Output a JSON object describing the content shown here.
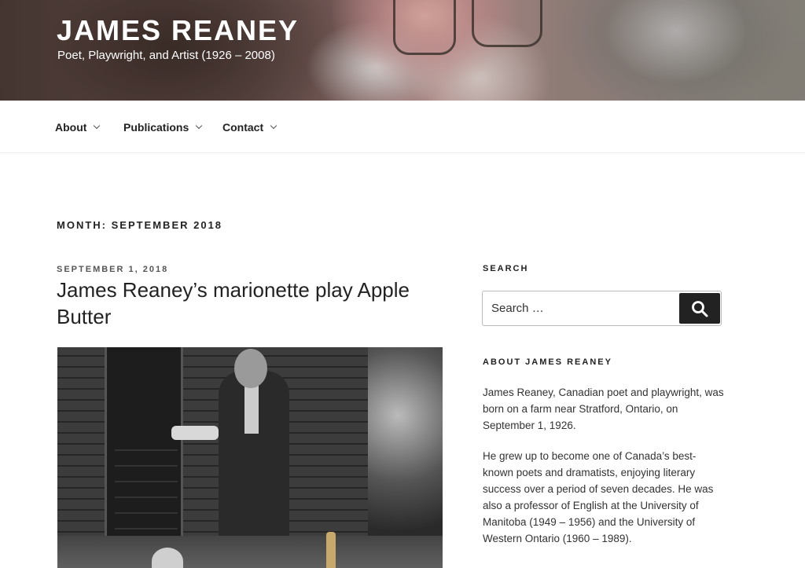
{
  "header": {
    "title": "JAMES REANEY",
    "tagline": "Poet, Playwright, and Artist (1926 – 2008)"
  },
  "nav": {
    "items": [
      {
        "label": "About"
      },
      {
        "label": "Publications"
      },
      {
        "label": "Contact"
      }
    ]
  },
  "main": {
    "archive_title": "MONTH: SEPTEMBER 2018",
    "post": {
      "date": "SEPTEMBER 1, 2018",
      "title": "James Reaney’s marionette play Apple Butter"
    }
  },
  "sidebar": {
    "search": {
      "title": "SEARCH",
      "placeholder": "Search …",
      "button_icon": "search-icon"
    },
    "about": {
      "title": "ABOUT JAMES REANEY",
      "paragraphs": [
        "James Reaney, Canadian poet and playwright, was born on a farm near Stratford, Ontario, on September 1, 1926.",
        "He grew up to become one of Canada’s best-known poets and dramatists, enjoying literary success over a period of seven decades. He was also a professor of English at the University of Manitoba (1949 – 1956) and the University of Western Ontario (1960 – 1989)."
      ]
    }
  },
  "colors": {
    "text": "#222222",
    "button": "#222222",
    "border": "#bbbbbb"
  }
}
